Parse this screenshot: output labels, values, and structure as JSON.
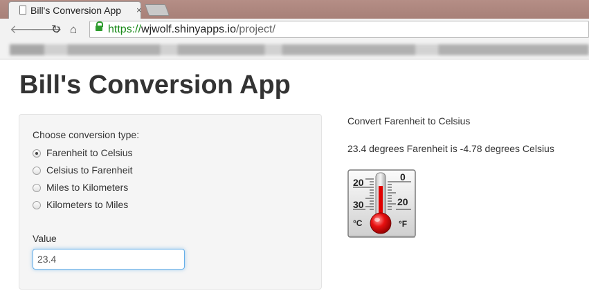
{
  "browser": {
    "tab_title": "Bill's Conversion App",
    "tab_close": "×",
    "url_scheme": "https://",
    "url_host": "wjwolf.shinyapps.io",
    "url_path": "/project/",
    "icons": [
      "document-icon",
      "back-icon",
      "forward-icon",
      "reload-icon",
      "home-icon",
      "lock-icon"
    ]
  },
  "app": {
    "title": "Bill's Conversion App",
    "conversion": {
      "label": "Choose conversion type:",
      "options": [
        {
          "label": "Farenheit to Celsius",
          "selected": true
        },
        {
          "label": "Celsius to Farenheit",
          "selected": false
        },
        {
          "label": "Miles to Kilometers",
          "selected": false
        },
        {
          "label": "Kilometers to Miles",
          "selected": false
        }
      ]
    },
    "value": {
      "label": "Value",
      "current": "23.4"
    },
    "output": {
      "heading": "Convert Farenheit to Celsius",
      "result": "23.4 degrees Farenheit is -4.78 degrees Celsius"
    },
    "thermometer": {
      "left_top": "20",
      "left_bottom": "30",
      "right_top": "0",
      "right_bottom": "20",
      "left_unit": "°C",
      "right_unit": "°F"
    }
  },
  "colors": {
    "text": "#333333",
    "url_scheme": "#1a8a1a",
    "input_focus": "#66afe9",
    "well_bg": "#f5f5f5",
    "mercury": "#e00000"
  }
}
